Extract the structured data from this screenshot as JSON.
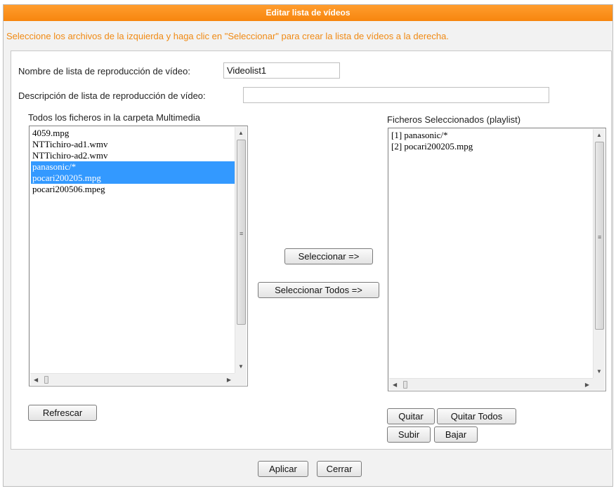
{
  "dialog": {
    "title": "Editar lista de vídeos",
    "instructions": "Seleccione los archivos de la izquierda y haga clic en \"Seleccionar\" para crear la lista de vídeos a la derecha."
  },
  "form": {
    "name_label": "Nombre de lista de reproducción de vídeo:",
    "name_value": "Videolist1",
    "description_label": "Descripción de lista de reproducción de vídeo:",
    "description_value": ""
  },
  "left_list": {
    "label": "Todos los ficheros in la carpeta Multimedia",
    "items": [
      {
        "text": "4059.mpg",
        "selected": false
      },
      {
        "text": "NTTichiro-ad1.wmv",
        "selected": false
      },
      {
        "text": "NTTichiro-ad2.wmv",
        "selected": false
      },
      {
        "text": "panasonic/*",
        "selected": true
      },
      {
        "text": "pocari200205.mpg",
        "selected": true
      },
      {
        "text": "pocari200506.mpeg",
        "selected": false
      }
    ]
  },
  "right_list": {
    "label": "Ficheros Seleccionados (playlist)",
    "items": [
      {
        "text": "[1] panasonic/*",
        "selected": false
      },
      {
        "text": "[2] pocari200205.mpg",
        "selected": false
      }
    ]
  },
  "buttons": {
    "select": "Seleccionar =>",
    "select_all": "Seleccionar Todos =>",
    "refresh": "Refrescar",
    "remove": "Quitar",
    "remove_all": "Quitar Todos",
    "up": "Subir",
    "down": "Bajar",
    "apply": "Aplicar",
    "close": "Cerrar"
  },
  "colors": {
    "title_bar": "#f7860e",
    "instructions_text": "#f08a14",
    "selection": "#3399ff"
  }
}
